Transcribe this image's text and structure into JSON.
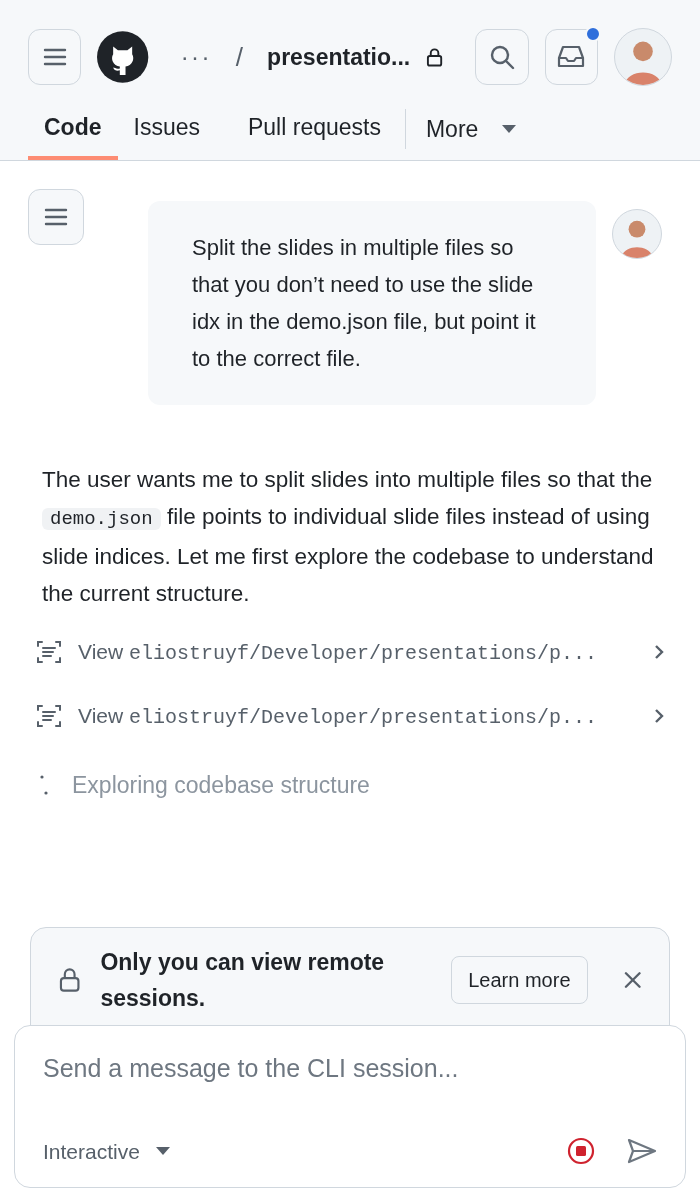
{
  "header": {
    "breadcrumb_ellipsis": "···",
    "separator": "/",
    "repo": "presentatio...",
    "private": true,
    "notifications_unread": true
  },
  "tabs": [
    {
      "label": "Code",
      "selected": true
    },
    {
      "label": "Issues",
      "selected": false
    },
    {
      "label": "Pull requests",
      "selected": false
    }
  ],
  "more": {
    "label": "More"
  },
  "user_message": "Split the slides in multiple files so that you don’t need to use the slide idx in the demo.json file, but point it to the correct file.",
  "assistant_message": {
    "before": "The user wants me to split slides into multiple files so that the",
    "code": "demo.json",
    "after": "file points to individual slide files instead of using slide indices. Let me first explore the codebase to understand the current structure."
  },
  "tool_calls": [
    {
      "action": "View",
      "path": "eliostruyf/Developer/presentations/p..."
    },
    {
      "action": "View",
      "path": "eliostruyf/Developer/presentations/p..."
    }
  ],
  "status": "Exploring codebase structure",
  "notice": {
    "text": "Only you can view remote sessions.",
    "button": "Learn more"
  },
  "composer": {
    "placeholder": "Send a message to the CLI session...",
    "mode": "Interactive"
  }
}
